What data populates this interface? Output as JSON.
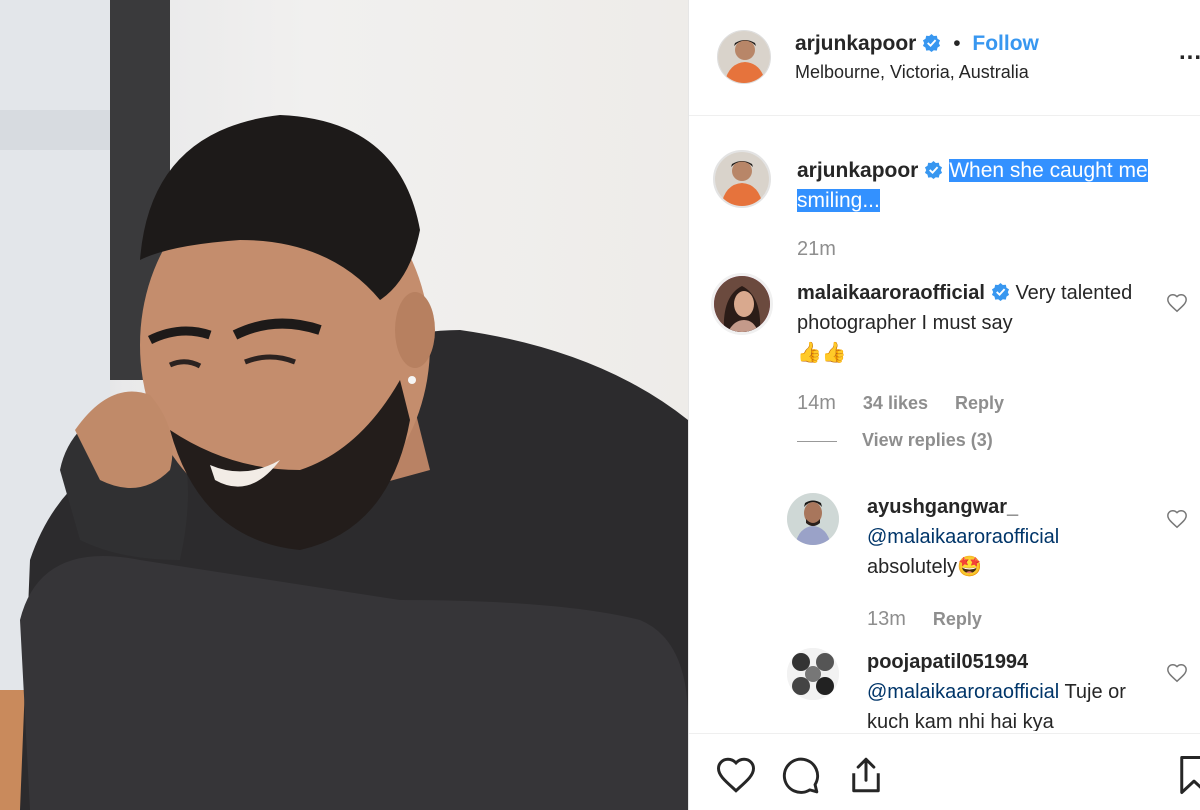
{
  "post": {
    "author": "arjunkapoor",
    "separator": "•",
    "follow_label": "Follow",
    "location": "Melbourne, Victoria, Australia",
    "more_label": "...",
    "caption_author": "arjunkapoor",
    "caption_text": "When she caught me smiling...",
    "caption_time": "21m"
  },
  "comments": [
    {
      "user": "malaikaaroraofficial",
      "text": "Very talented photographer I must say",
      "emoji": "👍👍",
      "time": "14m",
      "likes": "34 likes",
      "reply": "Reply",
      "view_replies": "View replies (3)"
    },
    {
      "user": "ayushgangwar_",
      "mention": "@malaikaaroraofficial",
      "text": "absolutely",
      "emoji": "🤩",
      "time": "13m",
      "reply": "Reply"
    },
    {
      "user": "poojapatil051994",
      "mention": "@malaikaaroraofficial",
      "text": "Tuje or kuch kam nhi hai kya"
    }
  ],
  "colors": {
    "link_blue": "#3897f0",
    "verified_blue": "#3897f0",
    "highlight": "#3391ff",
    "muted": "#8e8e8e"
  },
  "icons": [
    "verified-badge-icon",
    "heart-icon",
    "comment-icon",
    "share-icon",
    "bookmark-icon",
    "more-options-icon"
  ]
}
